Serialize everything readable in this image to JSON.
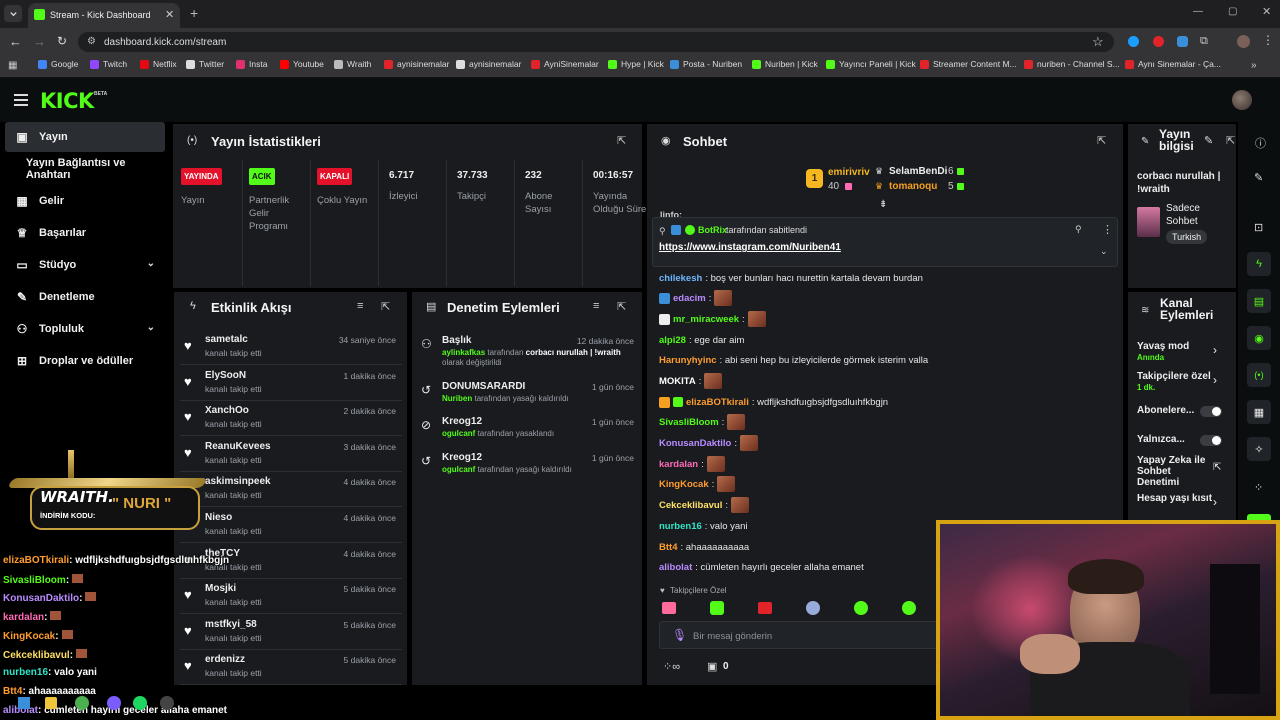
{
  "browser": {
    "tab_title": "Stream - Kick Dashboard",
    "url": "dashboard.kick.com/stream",
    "bookmarks": [
      "Google",
      "Twitch",
      "Netflix",
      "Twitter",
      "Insta",
      "Youtube",
      "Wraith",
      "aynisinemalar",
      "aynisinemalar",
      "AyniSinemalar",
      "Hype | Kick",
      "Posta - Nuriben",
      "Nuriben | Kick",
      "Yayıncı Paneli | Kick",
      "Streamer Content M...",
      "nuriben - Channel S...",
      "Aynı Sinemalar - Ça..."
    ]
  },
  "kick": {
    "logo": "KICK",
    "beta": "BETA"
  },
  "nav": [
    {
      "label": "Yayın",
      "icon": "broadcast-icon"
    },
    {
      "label": "Yayın Bağlantısı ve Anahtarı",
      "icon": ""
    },
    {
      "label": "Gelir",
      "icon": "revenue-icon"
    },
    {
      "label": "Başarılar",
      "icon": "trophy-icon"
    },
    {
      "label": "Stüdyo",
      "icon": "studio-icon"
    },
    {
      "label": "Denetleme",
      "icon": "wrench-icon"
    },
    {
      "label": "Topluluk",
      "icon": "community-icon"
    },
    {
      "label": "Droplar ve ödüller",
      "icon": "drops-icon"
    }
  ],
  "stats": {
    "title": "Yayın İstatistikleri",
    "cols": [
      {
        "pill": "YAYINDA",
        "label": "Yayın",
        "color": "#e3112a"
      },
      {
        "pill": "ACIK",
        "label": "Partnerlik Gelir Programı",
        "color": "#53fc18"
      },
      {
        "pill": "KAPALI",
        "label": "Çoklu Yayın",
        "color": "#e3112a"
      },
      {
        "value": "6.717",
        "label": "İzleyici"
      },
      {
        "value": "37.733",
        "label": "Takipçi"
      },
      {
        "value": "232",
        "label": "Abone Sayısı"
      },
      {
        "value": "00:16:57",
        "label": "Yayında Olduğu Süre"
      }
    ]
  },
  "activity": {
    "title": "Etkinlik Akışı",
    "items": [
      {
        "name": "sametalc",
        "sub": "kanalı takip etti",
        "time": "34 saniye önce"
      },
      {
        "name": "ElySooN",
        "sub": "kanalı takip etti",
        "time": "1 dakika önce"
      },
      {
        "name": "XanchOo",
        "sub": "kanalı takip etti",
        "time": "2 dakika önce"
      },
      {
        "name": "ReanuKevees",
        "sub": "kanalı takip etti",
        "time": "3 dakika önce"
      },
      {
        "name": "askimsinpeek",
        "sub": "kanalı takip etti",
        "time": "4 dakika önce"
      },
      {
        "name": "Nieso",
        "sub": "kanalı takip etti",
        "time": "4 dakika önce"
      },
      {
        "name": "theTCY",
        "sub": "kanalı takip etti",
        "time": "4 dakika önce"
      },
      {
        "name": "Mosjki",
        "sub": "kanalı takip etti",
        "time": "5 dakika önce"
      },
      {
        "name": "mstfkyi_58",
        "sub": "kanalı takip etti",
        "time": "5 dakika önce"
      },
      {
        "name": "erdenizz",
        "sub": "kanalı takip etti",
        "time": "5 dakika önce"
      }
    ]
  },
  "moderation": {
    "title": "Denetim Eylemleri",
    "items": [
      {
        "title": "Başlık",
        "user": "aylinkafkas",
        "mid": "tarafından",
        "bold": "corbacı nurullah | !wraith",
        "tail": "olarak değiştirildi",
        "time": "12 dakika önce",
        "icon": "person-icon"
      },
      {
        "title": "DONUMSARARDI",
        "user": "Nuriben",
        "mid": "tarafından yasağı kaldırıldı",
        "bold": "",
        "tail": "",
        "time": "1 gün önce",
        "icon": "undo-icon"
      },
      {
        "title": "Kreog12",
        "user": "ogulcanf",
        "mid": "tarafından yasaklandı",
        "bold": "",
        "tail": "",
        "time": "1 gün önce",
        "icon": "ban-icon"
      },
      {
        "title": "Kreog12",
        "user": "ogulcanf",
        "mid": "tarafından yasağı kaldırıldı",
        "bold": "",
        "tail": "",
        "time": "1 gün önce",
        "icon": "undo-icon"
      }
    ]
  },
  "chat": {
    "title": "Sohbet",
    "leaders": [
      {
        "name": "emirivriv",
        "count": "40",
        "rank": "1"
      },
      {
        "name": "SelamBenDi",
        "count": "6"
      },
      {
        "name": "tomanoqu",
        "count": "5"
      }
    ],
    "pinned": {
      "bot": "BotRix",
      "text": "tarafından sabitlendi",
      "link": "https://www.instagram.com/Nuriben41"
    },
    "cut_line": "linfo:",
    "messages": [
      {
        "user": "chilekesh",
        "color": "#6fb7ff",
        "text": ": boş ver bunları hacı nurettin kartala devam burdan",
        "emote": false
      },
      {
        "user": "edacim",
        "color": "#b98cff",
        "text": ":",
        "emote": true
      },
      {
        "user": "mr_miracweek",
        "color": "#53fc18",
        "text": ":",
        "emote": true
      },
      {
        "user": "alpi28",
        "color": "#53fc18",
        "text": ": ege dar aim",
        "emote": false
      },
      {
        "user": "Harunyhyinc",
        "color": "#ff9d2e",
        "text": ": abi seni hep bu izleyicilerde görmek isterim valla",
        "emote": false
      },
      {
        "user": "MOKITA",
        "color": "#ffffff",
        "text": ":",
        "emote": true
      },
      {
        "user": "elizaBOTkirali",
        "color": "#ff9d2e",
        "text": ": wdfljkshdfuıgbsjdfgsdluıhfkbgjn",
        "emote": false
      },
      {
        "user": "SivasliBloom",
        "color": "#53fc18",
        "text": ":",
        "emote": true
      },
      {
        "user": "KonusanDaktilo",
        "color": "#b98cff",
        "text": ":",
        "emote": true
      },
      {
        "user": "kardalan",
        "color": "#ff6bb5",
        "text": ":",
        "emote": true
      },
      {
        "user": "KingKocak",
        "color": "#ff9d2e",
        "text": ":",
        "emote": true
      },
      {
        "user": "Cekceklibavul",
        "color": "#ffe066",
        "text": ":",
        "emote": true
      },
      {
        "user": "nurben16",
        "color": "#2ee6c8",
        "text": ": valo yani",
        "emote": false
      },
      {
        "user": "Btt4",
        "color": "#ff9d2e",
        "text": ": ahaaaaaaaaaa",
        "emote": false
      },
      {
        "user": "alibolat",
        "color": "#b98cff",
        "text": ": cümleten hayırlı geceler allaha emanet",
        "emote": false
      }
    ],
    "followers_only": "Takipçilere Özel",
    "input_placeholder": "Bir mesaj gönderin",
    "viewer_count": "0"
  },
  "stream_info": {
    "title": "Yayın bilgisi",
    "stream_title": "corbacı nurullah | !wraith",
    "category": "Sadece Sohbet",
    "tag": "Turkish"
  },
  "channel_actions": {
    "title": "Kanal Eylemleri",
    "items": [
      {
        "label": "Yavaş mod",
        "sub": "Anında",
        "kind": "chevron"
      },
      {
        "label": "Takipçilere özel",
        "sub": "1 dk.",
        "kind": "chevron"
      },
      {
        "label": "Abonelere...",
        "sub": "",
        "kind": "toggle"
      },
      {
        "label": "Yalnızca...",
        "sub": "",
        "kind": "toggle"
      },
      {
        "label": "Yapay Zeka ile Sohbet Denetimi",
        "sub": "",
        "kind": "external"
      },
      {
        "label": "Hesap yaşı kısıt",
        "sub": "",
        "kind": "chevron"
      }
    ]
  },
  "overlay": {
    "brand": "WRAITH.",
    "discount_label": "İNDİRİM KODU:",
    "code": "\" NURI \"",
    "chat": [
      {
        "user": "elizaBOTkirali",
        "text": ": wdfljkshdfuıgbsjdfgsdluıhfkbgjn",
        "color": "#ff9d2e"
      },
      {
        "user": "SivasliBloom",
        "text": ":",
        "color": "#53fc18"
      },
      {
        "user": "KonusanDaktilo",
        "text": ":",
        "color": "#b98cff"
      },
      {
        "user": "kardalan",
        "text": ":",
        "color": "#ff6bb5"
      },
      {
        "user": "KingKocak",
        "text": ":",
        "color": "#ff9d2e"
      },
      {
        "user": "Cekceklibavul",
        "text": ":",
        "color": "#ffe066"
      },
      {
        "user": "nurben16",
        "text": ": valo yani",
        "color": "#2ee6c8"
      },
      {
        "user": "Btt4",
        "text": ": ahaaaaaaaaaa",
        "color": "#ff9d2e"
      },
      {
        "user": "alibolat",
        "text": ": cümleten hayırlı geceler allaha emanet",
        "color": "#b98cff"
      }
    ]
  },
  "colors": {
    "accent": "#53fc18",
    "live": "#e3112a",
    "panel": "#191b1f"
  }
}
